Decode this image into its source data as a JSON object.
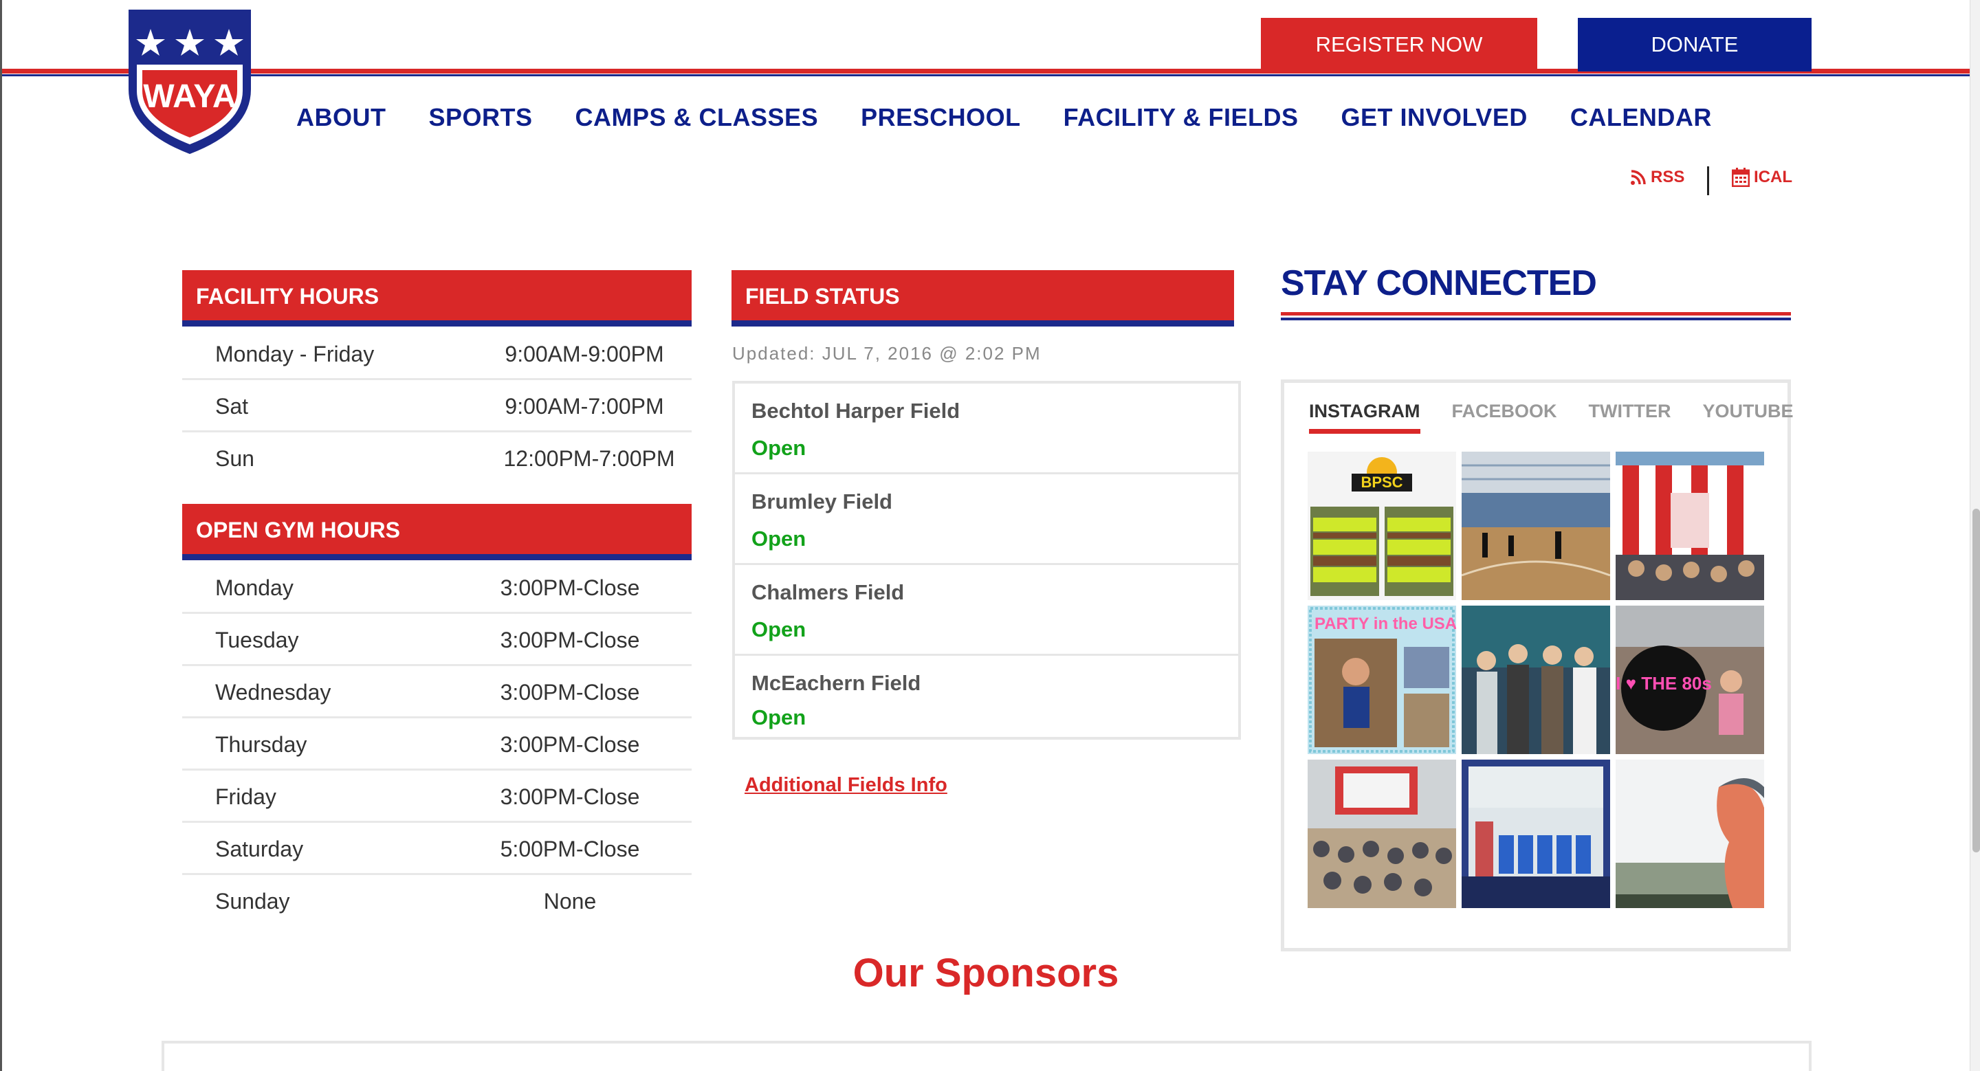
{
  "brand": {
    "logo_text": "WAYA"
  },
  "header": {
    "register_label": "REGISTER NOW",
    "donate_label": "DONATE"
  },
  "nav": [
    "ABOUT",
    "SPORTS",
    "CAMPS & CLASSES",
    "PRESCHOOL",
    "FACILITY & FIELDS",
    "GET INVOLVED",
    "CALENDAR"
  ],
  "feeds": {
    "rss": "RSS",
    "ical": "ICAL"
  },
  "facility_hours": {
    "title": "FACILITY HOURS",
    "rows": [
      {
        "day": "Monday - Friday",
        "time": "9:00AM-9:00PM"
      },
      {
        "day": "Sat",
        "time": "9:00AM-7:00PM"
      },
      {
        "day": "Sun",
        "time": "12:00PM-7:00PM"
      }
    ]
  },
  "open_gym": {
    "title": "OPEN GYM HOURS",
    "rows": [
      {
        "day": "Monday",
        "time": "3:00PM-Close"
      },
      {
        "day": "Tuesday",
        "time": "3:00PM-Close"
      },
      {
        "day": "Wednesday",
        "time": "3:00PM-Close"
      },
      {
        "day": "Thursday",
        "time": "3:00PM-Close"
      },
      {
        "day": "Friday",
        "time": "3:00PM-Close"
      },
      {
        "day": "Saturday",
        "time": "5:00PM-Close"
      },
      {
        "day": "Sunday",
        "time": "None"
      }
    ]
  },
  "field_status": {
    "title": "FIELD STATUS",
    "updated": "Updated: JUL 7, 2016 @ 2:02 PM",
    "fields": [
      {
        "name": "Bechtol Harper Field",
        "status": "Open"
      },
      {
        "name": "Brumley Field",
        "status": "Open"
      },
      {
        "name": "Chalmers Field",
        "status": "Open"
      },
      {
        "name": "McEachern Field",
        "status": "Open"
      }
    ],
    "additional_link": "Additional Fields Info"
  },
  "social": {
    "title": "STAY CONNECTED",
    "tabs": [
      "INSTAGRAM",
      "FACEBOOK",
      "TWITTER",
      "YOUTUBE"
    ],
    "active_tab": "INSTAGRAM",
    "photo_captions": [
      "BPSC",
      "PARTY in the USA",
      "I ♥ THE 80s"
    ]
  },
  "sponsors": {
    "title": "Our Sponsors"
  },
  "colors": {
    "red": "#d92828",
    "blue": "#0d1f8a",
    "open_green": "#12a21a"
  }
}
